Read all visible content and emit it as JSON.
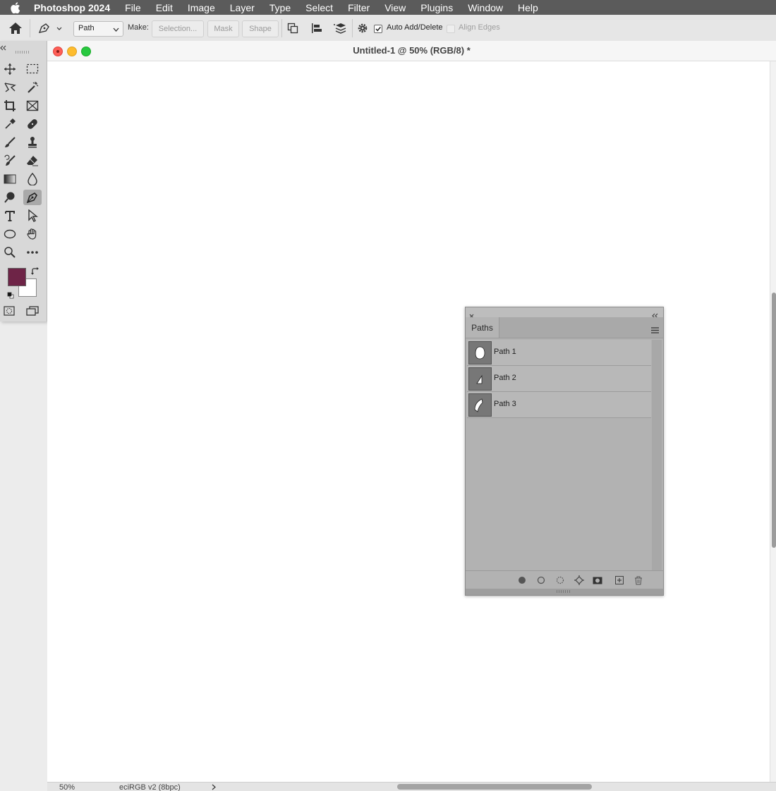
{
  "menubar": {
    "app_name": "Photoshop 2024",
    "items": [
      "File",
      "Edit",
      "Image",
      "Layer",
      "Type",
      "Select",
      "Filter",
      "View",
      "Plugins",
      "Window",
      "Help"
    ]
  },
  "options_bar": {
    "mode_value": "Path",
    "make_label": "Make:",
    "selection_label": "Selection...",
    "mask_label": "Mask",
    "shape_label": "Shape",
    "auto_add_delete_label": "Auto Add/Delete",
    "auto_add_delete_checked": true,
    "align_edges_label": "Align Edges",
    "align_edges_checked": false
  },
  "document": {
    "title": "Untitled-1 @ 50% (RGB/8) *"
  },
  "toolbox": {
    "foreground_color": "#6e2447",
    "background_color": "#ffffff",
    "active_tool": "pen-tool"
  },
  "paths_panel": {
    "tab_label": "Paths",
    "paths": [
      {
        "name": "Path 1"
      },
      {
        "name": "Path 2"
      },
      {
        "name": "Path 3"
      }
    ]
  },
  "status_bar": {
    "zoom": "50%",
    "doc_info": "eciRGB v2 (8bpc)"
  }
}
